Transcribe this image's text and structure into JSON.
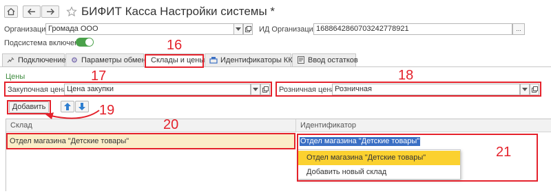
{
  "window": {
    "title": "БИФИТ Касса Настройки системы *"
  },
  "form": {
    "org_label": "Организация:",
    "org_value": "Громада ООО",
    "org_id_label": "ИД Организации:",
    "org_id_value": "1688642860703242778921",
    "more_button": "...",
    "subsystem_label": "Подсистема включена:"
  },
  "tabs": [
    {
      "label": "Подключение",
      "icon": "connection-icon"
    },
    {
      "label": "Параметры обмена",
      "icon": "gear-icon"
    },
    {
      "label": "Склады и цены",
      "icon": ""
    },
    {
      "label": "Идентификаторы ККМ",
      "icon": "cash-register-icon"
    },
    {
      "label": "Ввод остатков",
      "icon": "document-icon"
    }
  ],
  "prices": {
    "section_title": "Цены",
    "purchase_label": "Закупочная цена:",
    "purchase_value": "Цена закупки",
    "retail_label": "Розничная цена:",
    "retail_value": "Розничная"
  },
  "toolbar": {
    "add_label": "Добавить"
  },
  "table": {
    "columns": [
      "Склад",
      "Идентификатор"
    ],
    "rows": [
      {
        "warehouse": "Отдел магазина \"Детские товары\"",
        "identifier": "Отдел магазина \"Детские товары\""
      }
    ]
  },
  "dropdown": {
    "items": [
      "Отдел магазина \"Детские товары\"",
      "Добавить новый склад"
    ]
  },
  "annotations": [
    "16",
    "17",
    "18",
    "19",
    "20",
    "21"
  ],
  "colors": {
    "annotation": "#e4212b",
    "toggle_on": "#4aa14a",
    "row_highlight": "#fbeec8",
    "dropdown_highlight": "#fbd130",
    "selection": "#3a6fc4",
    "section_title": "#3c8a3c"
  }
}
